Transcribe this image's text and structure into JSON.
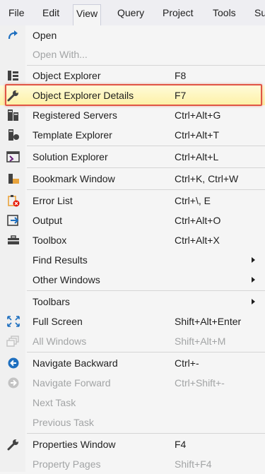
{
  "menubar": {
    "items": [
      "File",
      "Edit",
      "View",
      "Query",
      "Project",
      "Tools",
      "Su"
    ],
    "active": "View"
  },
  "menu": {
    "items": [
      {
        "label": "Open",
        "shortcut": "",
        "icon": "open-redo-arrow-icon",
        "disabled": false
      },
      {
        "label": "Open With...",
        "shortcut": "",
        "icon": "",
        "disabled": true
      },
      {
        "label": "Object Explorer",
        "shortcut": "F8",
        "icon": "object-explorer-icon",
        "disabled": false
      },
      {
        "label": "Object Explorer Details",
        "shortcut": "F7",
        "icon": "wrench-icon",
        "disabled": false,
        "highlighted": true
      },
      {
        "label": "Registered Servers",
        "shortcut": "Ctrl+Alt+G",
        "icon": "registered-servers-icon",
        "disabled": false
      },
      {
        "label": "Template Explorer",
        "shortcut": "Ctrl+Alt+T",
        "icon": "template-explorer-icon",
        "disabled": false
      },
      {
        "label": "Solution Explorer",
        "shortcut": "Ctrl+Alt+L",
        "icon": "solution-explorer-icon",
        "disabled": false
      },
      {
        "label": "Bookmark Window",
        "shortcut": "Ctrl+K, Ctrl+W",
        "icon": "bookmark-window-icon",
        "disabled": false
      },
      {
        "label": "Error List",
        "shortcut": "Ctrl+\\, E",
        "icon": "error-list-icon",
        "disabled": false
      },
      {
        "label": "Output",
        "shortcut": "Ctrl+Alt+O",
        "icon": "output-icon",
        "disabled": false
      },
      {
        "label": "Toolbox",
        "shortcut": "Ctrl+Alt+X",
        "icon": "toolbox-icon",
        "disabled": false
      },
      {
        "label": "Find Results",
        "shortcut": "",
        "icon": "",
        "disabled": false,
        "submenu": true
      },
      {
        "label": "Other Windows",
        "shortcut": "",
        "icon": "",
        "disabled": false,
        "submenu": true
      },
      {
        "label": "Toolbars",
        "shortcut": "",
        "icon": "",
        "disabled": false,
        "submenu": true
      },
      {
        "label": "Full Screen",
        "shortcut": "Shift+Alt+Enter",
        "icon": "full-screen-icon",
        "disabled": false
      },
      {
        "label": "All Windows",
        "shortcut": "Shift+Alt+M",
        "icon": "all-windows-icon",
        "disabled": true
      },
      {
        "label": "Navigate Backward",
        "shortcut": "Ctrl+-",
        "icon": "navigate-backward-icon",
        "disabled": false
      },
      {
        "label": "Navigate Forward",
        "shortcut": "Ctrl+Shift+-",
        "icon": "navigate-forward-icon",
        "disabled": true
      },
      {
        "label": "Next Task",
        "shortcut": "",
        "icon": "",
        "disabled": true
      },
      {
        "label": "Previous Task",
        "shortcut": "",
        "icon": "",
        "disabled": true
      },
      {
        "label": "Properties Window",
        "shortcut": "F4",
        "icon": "wrench-icon",
        "disabled": false
      },
      {
        "label": "Property Pages",
        "shortcut": "Shift+F4",
        "icon": "",
        "disabled": true
      }
    ]
  },
  "colors": {
    "highlight_border": "#e05545",
    "highlight_fill": "#fdf1a6",
    "disabled_text": "#a2a4a5",
    "accent_blue": "#1e6fbf"
  }
}
